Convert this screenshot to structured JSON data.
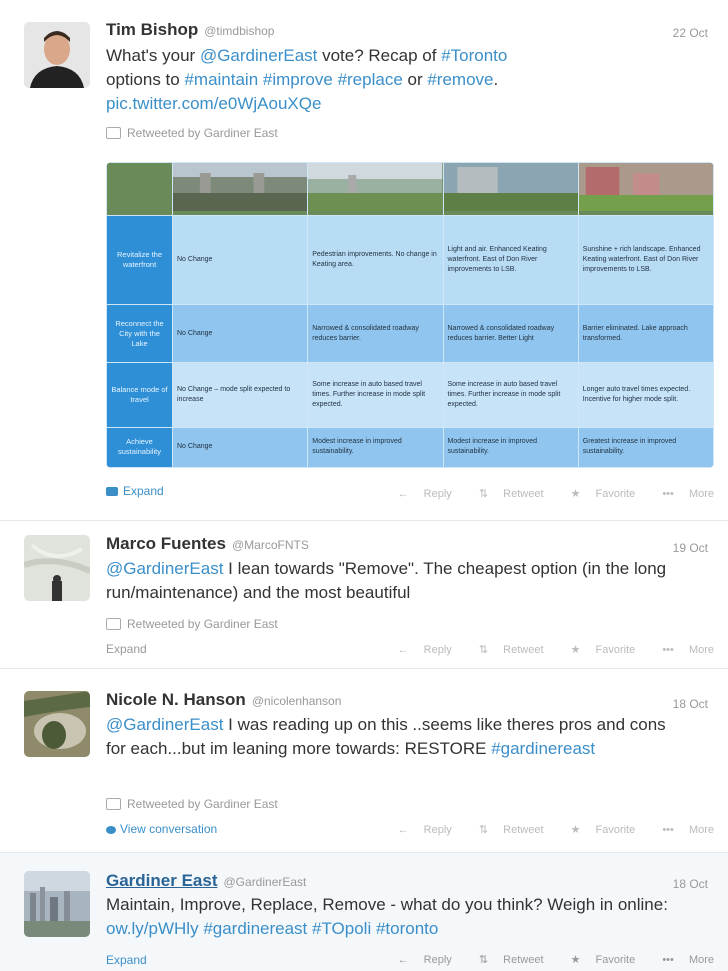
{
  "tweets": [
    {
      "name": "Tim Bishop",
      "handle": "@timdbishop",
      "date": "22 Oct",
      "text_parts": [
        "What's your ",
        "@GardinerEast",
        " vote?  Recap of ",
        "#Toronto",
        " options to ",
        "#maintain",
        " ",
        "#improve",
        " ",
        "#replace",
        " or ",
        "#remove",
        ".",
        "pic.twitter.com/e0WjAouXQe"
      ],
      "retweeted_by": "Retweeted by Gardiner East",
      "expand": "Expand",
      "actions": [
        "Reply",
        "Retweet",
        "Favorite",
        "More"
      ]
    },
    {
      "name": "Marco Fuentes",
      "handle": "@MarcoFNTS",
      "date": "19 Oct",
      "text_parts": [
        "@GardinerEast",
        " I lean towards \"Remove\". The cheapest option (in the long run/maintenance) and the most beautiful"
      ],
      "retweeted_by": "Retweeted by Gardiner East",
      "expand": "Expand",
      "actions": [
        "Reply",
        "Retweet",
        "Favorite",
        "More"
      ]
    },
    {
      "name": "Nicole N. Hanson",
      "handle": "@nicolenhanson",
      "date": "18 Oct",
      "text_parts": [
        "@GardinerEast",
        " I was reading up on this ..seems like theres pros and cons for each...but im leaning more towards: RESTORE ",
        "#gardinereast"
      ],
      "retweeted_by": "Retweeted by Gardiner East",
      "expand": "View conversation",
      "actions": [
        "Reply",
        "Retweet",
        "Favorite",
        "More"
      ]
    },
    {
      "name": "Gardiner East",
      "handle": "@GardinerEast",
      "date": "18 Oct",
      "text_parts": [
        "Maintain, Improve, Replace, Remove - what do you think? Weigh in online: ",
        "ow.ly/pWHly",
        "  ",
        "#gardinereast",
        " ",
        "#TOpoli",
        " ",
        "#toronto"
      ],
      "expand": "Expand",
      "actions": [
        "Reply",
        "Retweet",
        "Favorite",
        "More"
      ]
    }
  ],
  "table": {
    "rows": [
      {
        "header": "Revitalize the waterfront",
        "cells": [
          "No Change",
          "Pedestrian improvements. No change in Keating area.",
          "Light and air. Enhanced Keating waterfront. East of Don River improvements to LSB.",
          "Sunshine + rich landscape. Enhanced Keating waterfront. East of Don River improvements to LSB."
        ]
      },
      {
        "header": "Reconnect the City with the Lake",
        "cells": [
          "No Change",
          "Narrowed & consolidated roadway reduces barrier.",
          "Narrowed & consolidated roadway reduces barrier. Better Light",
          "Barrier eliminated. Lake approach transformed."
        ]
      },
      {
        "header": "Balance mode of travel",
        "cells": [
          "No Change – mode split expected to increase",
          "Some increase in auto based travel times. Further increase in mode split expected.",
          "Some increase in auto based travel times. Further increase in mode split expected.",
          "Longer auto travel times expected. Incentive for higher mode split."
        ]
      },
      {
        "header": "Achieve sustainability",
        "cells": [
          "No Change",
          "Modest increase in improved sustainability.",
          "Modest increase in improved sustainability.",
          "Greatest increase in improved sustainability."
        ]
      }
    ]
  },
  "icons": {
    "reply": "reply-arrow-icon",
    "retweet": "retweet-icon",
    "favorite": "star-icon",
    "more": "ellipsis-icon",
    "expand": "photo-icon",
    "conversation": "speech-bubble-icon"
  },
  "colors": {
    "link": "#3b8fc9",
    "muted": "#999999",
    "table_blue": "#2e8fd6"
  }
}
